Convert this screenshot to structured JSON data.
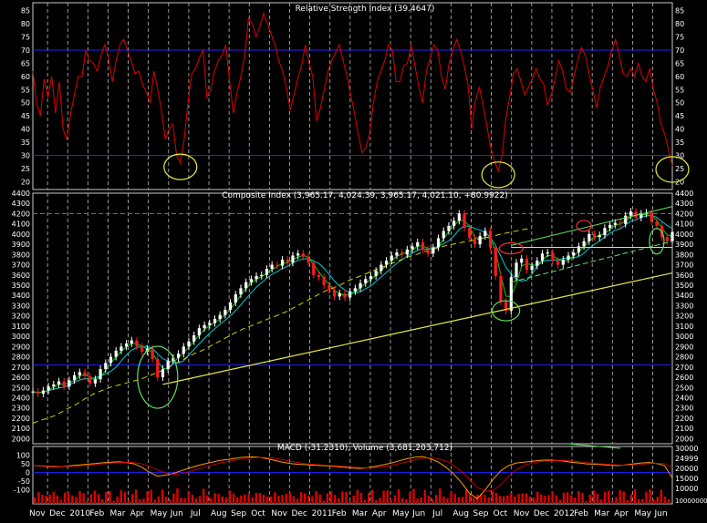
{
  "colors": {
    "background": "#000000",
    "frame": "#c8c8c8",
    "grid": "#bdbdbd",
    "text": "#ffffff",
    "rsi_line": "#e00000",
    "rsi_levels": "#2020ff",
    "price_up": "#ffffff",
    "price_down": "#ff1a1a",
    "ma_short": "#00d000",
    "ma_mid": "#00c8c8",
    "ma_long": "#d0d000",
    "support": "#e8e84a",
    "channel": "#60e060",
    "resistance": "#ff3030",
    "circle_yellow": "#e8e84a",
    "circle_green": "#60e060",
    "circle_red": "#ff3030",
    "macd_line": "#ff9900",
    "macd_zero": "#2020ff",
    "volume": "#e00000"
  },
  "x_axis": {
    "labels": [
      "Nov",
      "Dec",
      "2010",
      "Feb",
      "Mar",
      "Apr",
      "May",
      "Jun",
      "Jul",
      "Aug",
      "Sep",
      "Oct",
      "Nov",
      "Dec",
      "2011",
      "Feb",
      "Mar",
      "Apr",
      "May",
      "Jun",
      "Jul",
      "Aug",
      "Sep",
      "Oct",
      "Nov",
      "Dec",
      "2012",
      "Feb",
      "Mar",
      "Apr",
      "May",
      "Jun"
    ]
  },
  "chart_data": [
    {
      "type": "line",
      "title": "Relative Strength Index (39.4647)",
      "ylim": [
        17,
        88
      ],
      "y_ticks": [
        20,
        25,
        30,
        35,
        40,
        45,
        50,
        55,
        60,
        65,
        70,
        75,
        80,
        85
      ],
      "levels": [
        30,
        70
      ],
      "series": [
        {
          "values": [
            62,
            50,
            45,
            59,
            52,
            60,
            46,
            58,
            40,
            36,
            46,
            53,
            60,
            60,
            70,
            66,
            65,
            62,
            68,
            72,
            67,
            58,
            66,
            72,
            74,
            70,
            66,
            61,
            62,
            57,
            54,
            50,
            62,
            55,
            47,
            36,
            40,
            42,
            30,
            27,
            36,
            50,
            61,
            63,
            67,
            70,
            52,
            55,
            62,
            66,
            68,
            72,
            58,
            46,
            54,
            60,
            68,
            82,
            80,
            75,
            79,
            84,
            80,
            76,
            72,
            66,
            62,
            56,
            47,
            53,
            59,
            64,
            72,
            65,
            60,
            43,
            48,
            55,
            62,
            66,
            69,
            72,
            66,
            60,
            53,
            46,
            38,
            31,
            33,
            38,
            50,
            58,
            62,
            66,
            72,
            70,
            58,
            58,
            64,
            65,
            72,
            64,
            56,
            50,
            62,
            67,
            72,
            70,
            60,
            55,
            65,
            70,
            74,
            70,
            64,
            57,
            40,
            51,
            56,
            49,
            41,
            33,
            28,
            24,
            30,
            44,
            52,
            61,
            63,
            58,
            53,
            56,
            59,
            63,
            59,
            57,
            49,
            53,
            59,
            66,
            62,
            55,
            54,
            60,
            66,
            71,
            68,
            61,
            55,
            48,
            56,
            60,
            64,
            70,
            74,
            68,
            61,
            60,
            63,
            60,
            65,
            60,
            58,
            63,
            55,
            50,
            42,
            38,
            32,
            26
          ]
        }
      ]
    },
    {
      "type": "line",
      "title": "Composite Index (3,965.17, 4,024.39, 3,965.17, 4,021.10, +80.9922)",
      "ylim": [
        1950,
        4400
      ],
      "y_ticks": [
        2000,
        2100,
        2200,
        2300,
        2400,
        2500,
        2600,
        2700,
        2800,
        2900,
        3000,
        3100,
        3200,
        3300,
        3400,
        3500,
        3600,
        3700,
        3800,
        3900,
        4000,
        4100,
        4200,
        4300,
        4400
      ],
      "horizontal_levels": [
        2720,
        4200
      ],
      "series": [
        {
          "name": "close",
          "values": [
            2460,
            2440,
            2470,
            2510,
            2530,
            2560,
            2510,
            2570,
            2620,
            2650,
            2610,
            2540,
            2580,
            2680,
            2740,
            2800,
            2860,
            2900,
            2930,
            2960,
            2900,
            2850,
            2880,
            2780,
            2600,
            2680,
            2760,
            2790,
            2830,
            2900,
            2950,
            3010,
            3080,
            3110,
            3130,
            3170,
            3210,
            3260,
            3330,
            3410,
            3470,
            3530,
            3560,
            3590,
            3600,
            3660,
            3700,
            3690,
            3750,
            3720,
            3790,
            3810,
            3780,
            3720,
            3600,
            3580,
            3500,
            3450,
            3390,
            3420,
            3380,
            3440,
            3470,
            3520,
            3560,
            3590,
            3640,
            3700,
            3740,
            3790,
            3820,
            3800,
            3850,
            3880,
            3920,
            3850,
            3810,
            3870,
            3960,
            4030,
            4080,
            4130,
            4200,
            4060,
            3960,
            3900,
            3980,
            4030,
            3870,
            3590,
            3340,
            3250,
            3580,
            3720,
            3760,
            3650,
            3690,
            3740,
            3810,
            3820,
            3740,
            3700,
            3750,
            3790,
            3820,
            3880,
            3930,
            4000,
            3970,
            3990,
            4060,
            4090,
            4110,
            4100,
            4180,
            4220,
            4160,
            4200,
            4210,
            4120,
            4080,
            3970,
            3930,
            4021
          ]
        },
        {
          "name": "ma_long",
          "values": [
            2150,
            2180,
            2200,
            2230,
            2270,
            2310,
            2350,
            2400,
            2440,
            2470,
            2500,
            2520,
            2540,
            2560,
            2580,
            2610,
            2640,
            2670,
            2710,
            2750,
            2790,
            2830,
            2860,
            2900,
            2940,
            2980,
            3020,
            3060,
            3090,
            3120,
            3150,
            3180,
            3210,
            3240,
            3280,
            3320,
            3360,
            3400,
            3440,
            3470,
            3500,
            3540,
            3570,
            3600,
            3630,
            3660,
            3690,
            3720,
            3750,
            3780,
            3800,
            3830,
            3850,
            3870,
            3890,
            3905,
            3920,
            3935,
            3950,
            3965,
            3980,
            4000,
            4015,
            4030,
            4045,
            4060
          ]
        }
      ],
      "annotations": {
        "support_line": {
          "from_value": 2530,
          "to_value": 3620
        },
        "channel_upper": {
          "from_value": 3890,
          "to_value": 4270
        },
        "channel_lower": {
          "from_value": 3530,
          "to_value": 3930
        },
        "flat_line": {
          "value": 3870
        }
      }
    },
    {
      "type": "bar",
      "title": "MACD (-31.2310), Volume (3,681,203,712)",
      "ylim": [
        -180,
        150
      ],
      "y_ticks_left": [
        100,
        50,
        0,
        -50,
        -100
      ],
      "y_ticks_right": [
        "30000",
        "24999",
        "20000",
        "15000",
        "10000"
      ],
      "y_ticks_right_bottom": "10000000",
      "series": [
        {
          "name": "macd",
          "values": [
            40,
            38,
            35,
            33,
            36,
            40,
            44,
            48,
            52,
            56,
            60,
            62,
            58,
            50,
            30,
            0,
            -20,
            -15,
            -5,
            10,
            25,
            38,
            50,
            60,
            70,
            75,
            82,
            88,
            90,
            88,
            80,
            70,
            60,
            52,
            48,
            45,
            42,
            40,
            38,
            34,
            30,
            26,
            24,
            28,
            36,
            45,
            55,
            68,
            80,
            88,
            92,
            80,
            60,
            30,
            -10,
            -60,
            -120,
            -150,
            -100,
            -40,
            10,
            40,
            55,
            60,
            65,
            70,
            72,
            70,
            66,
            60,
            55,
            50,
            48,
            45,
            42,
            40,
            44,
            50,
            55,
            58,
            52,
            40,
            -31
          ]
        }
      ]
    }
  ]
}
